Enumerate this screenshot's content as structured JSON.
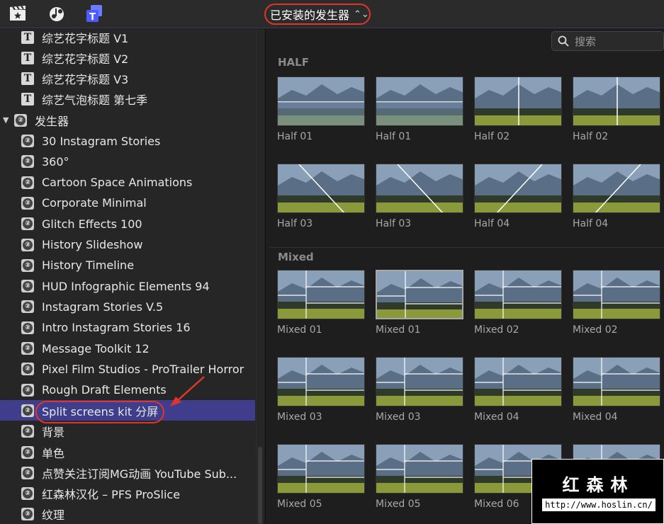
{
  "toolbar": {
    "icons": [
      "clapper-star-icon",
      "music-camera-icon",
      "titles-generators-icon"
    ],
    "dropdown_label": "已安装的发生器"
  },
  "search": {
    "placeholder": "搜索"
  },
  "sidebar": {
    "items": [
      {
        "label": "综艺花字标题 V1",
        "icon": "title-t-icon"
      },
      {
        "label": "综艺花字标题 V2",
        "icon": "title-t-icon"
      },
      {
        "label": "综艺花字标题 V3",
        "icon": "title-t-icon"
      },
      {
        "label": "综艺气泡标题 第七季",
        "icon": "title-t-icon"
      },
      {
        "label": "发生器",
        "icon": "generator-icon",
        "folder": true
      },
      {
        "label": "30 Instagram Stories",
        "icon": "generator-icon"
      },
      {
        "label": "360°",
        "icon": "generator-icon"
      },
      {
        "label": "Cartoon Space Animations",
        "icon": "generator-icon"
      },
      {
        "label": "Corporate Minimal",
        "icon": "generator-icon"
      },
      {
        "label": "Glitch Effects 100",
        "icon": "generator-icon"
      },
      {
        "label": "History Slideshow",
        "icon": "generator-icon"
      },
      {
        "label": "History Timeline",
        "icon": "generator-icon"
      },
      {
        "label": "HUD Infographic Elements 94",
        "icon": "generator-icon"
      },
      {
        "label": "Instagram Stories V.5",
        "icon": "generator-icon"
      },
      {
        "label": "Intro Instagram Stories 16",
        "icon": "generator-icon"
      },
      {
        "label": "Message Toolkit 12",
        "icon": "generator-icon"
      },
      {
        "label": "Pixel Film Studios - ProTrailer Horror",
        "icon": "generator-icon"
      },
      {
        "label": "Rough Draft Elements",
        "icon": "generator-icon"
      },
      {
        "label": "Split screens kit 分屏",
        "icon": "generator-icon",
        "selected": true
      },
      {
        "label": "背景",
        "icon": "generator-icon"
      },
      {
        "label": "单色",
        "icon": "generator-icon"
      },
      {
        "label": "点赞关注订阅MG动画 YouTube Sub...",
        "icon": "generator-icon"
      },
      {
        "label": "红森林汉化 – PFS ProSlice",
        "icon": "generator-icon"
      },
      {
        "label": "纹理",
        "icon": "generator-icon"
      }
    ]
  },
  "browser": {
    "sections": [
      {
        "title": "HALF",
        "captions": [
          "Half 01",
          "Half 01",
          "Half 02",
          "Half 02",
          "Half 03",
          "Half 03",
          "Half 04",
          "Half 04"
        ]
      },
      {
        "title": "Mixed",
        "captions": [
          "Mixed 01",
          "Mixed 01",
          "Mixed 02",
          "Mixed 02",
          "Mixed 03",
          "Mixed 03",
          "Mixed 04",
          "Mixed 04",
          "Mixed 05",
          "Mixed 05",
          "Mixed 06",
          ""
        ]
      }
    ]
  },
  "watermark": {
    "title": "红森林",
    "url": "http://www.hoslin.cn/"
  },
  "colors": {
    "selection": "#3f3d8c",
    "highlight_ring": "#e0352b"
  }
}
